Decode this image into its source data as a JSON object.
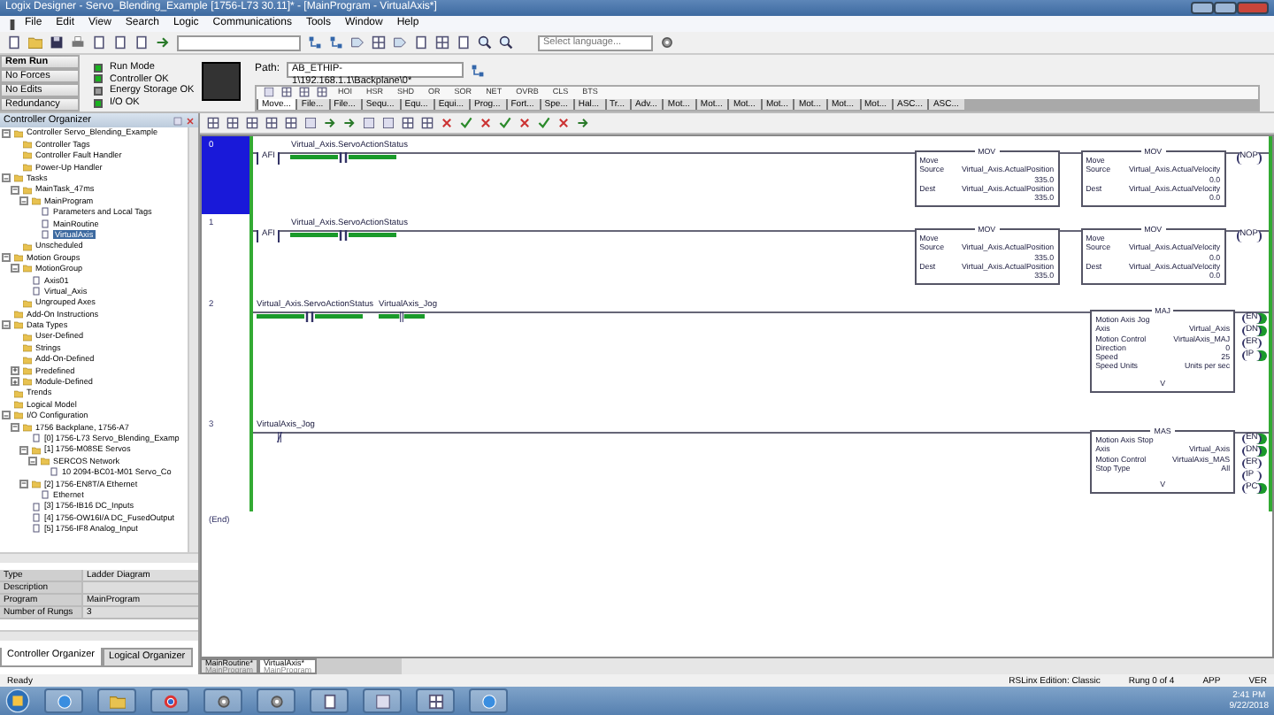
{
  "window": {
    "title": "Logix Designer - Servo_Blending_Example [1756-L73 30.11]* - [MainProgram - VirtualAxis*]"
  },
  "menu": [
    "File",
    "Edit",
    "View",
    "Search",
    "Logic",
    "Communications",
    "Tools",
    "Window",
    "Help"
  ],
  "language_field": {
    "placeholder": "Select language..."
  },
  "controller_status": {
    "modes": [
      {
        "label": "Rem Run"
      },
      {
        "label": "No Forces"
      },
      {
        "label": "No Edits"
      },
      {
        "label": "Redundancy"
      }
    ],
    "indicators": [
      {
        "label": "Run Mode",
        "on": true
      },
      {
        "label": "Controller OK",
        "on": true
      },
      {
        "label": "Energy Storage OK",
        "on": false
      },
      {
        "label": "I/O OK",
        "on": true
      }
    ]
  },
  "path": {
    "label": "Path:",
    "value": "AB_ETHIP-1\\192.168.1.1\\Backplane\\0*"
  },
  "instruction_buttons": [
    "HOI",
    "HSR",
    "SHD",
    "OR",
    "SOR",
    "NET",
    "OVRB",
    "CLS",
    "BTS"
  ],
  "instruction_tabs": [
    {
      "label": "Move...",
      "selected": true
    },
    {
      "label": "File...",
      "selected": false
    },
    {
      "label": "File...",
      "selected": false
    },
    {
      "label": "Sequ...",
      "selected": false
    },
    {
      "label": "Equ...",
      "selected": false
    },
    {
      "label": "Equi...",
      "selected": false
    },
    {
      "label": "Prog...",
      "selected": false
    },
    {
      "label": "Fort...",
      "selected": false
    },
    {
      "label": "Spe...",
      "selected": false
    },
    {
      "label": "Hal...",
      "selected": false
    },
    {
      "label": "Tr...",
      "selected": false
    },
    {
      "label": "Adv...",
      "selected": false
    },
    {
      "label": "Mot...",
      "selected": false
    },
    {
      "label": "Mot...",
      "selected": false
    },
    {
      "label": "Mot...",
      "selected": false
    },
    {
      "label": "Mot...",
      "selected": false
    },
    {
      "label": "Mot...",
      "selected": false
    },
    {
      "label": "Mot...",
      "selected": false
    },
    {
      "label": "Mot...",
      "selected": false
    },
    {
      "label": "ASC...",
      "selected": false
    },
    {
      "label": "ASC...",
      "selected": false
    }
  ],
  "organizer": {
    "title": "Controller Organizer",
    "tree": [
      {
        "label": "Controller Servo_Blending_Example",
        "expanded": true,
        "children": [
          {
            "label": "Controller Tags"
          },
          {
            "label": "Controller Fault Handler"
          },
          {
            "label": "Power-Up Handler"
          }
        ]
      },
      {
        "label": "Tasks",
        "expanded": true,
        "children": [
          {
            "label": "MainTask_47ms",
            "expanded": true,
            "children": [
              {
                "label": "MainProgram",
                "expanded": true,
                "children": [
                  {
                    "label": "Parameters and Local Tags"
                  },
                  {
                    "label": "MainRoutine"
                  },
                  {
                    "label": "VirtualAxis",
                    "selected": true
                  }
                ]
              }
            ]
          },
          {
            "label": "Unscheduled"
          }
        ]
      },
      {
        "label": "Motion Groups",
        "expanded": true,
        "children": [
          {
            "label": "MotionGroup",
            "expanded": true,
            "children": [
              {
                "label": "Axis01"
              },
              {
                "label": "Virtual_Axis"
              }
            ]
          },
          {
            "label": "Ungrouped Axes"
          }
        ]
      },
      {
        "label": "Add-On Instructions"
      },
      {
        "label": "Data Types",
        "expanded": true,
        "children": [
          {
            "label": "User-Defined"
          },
          {
            "label": "Strings"
          },
          {
            "label": "Add-On-Defined"
          },
          {
            "label": "Predefined",
            "expanded": false
          },
          {
            "label": "Module-Defined",
            "expanded": false
          }
        ]
      },
      {
        "label": "Trends"
      },
      {
        "label": "Logical Model"
      },
      {
        "label": "I/O Configuration",
        "expanded": true,
        "children": [
          {
            "label": "1756 Backplane, 1756-A7",
            "expanded": true,
            "children": [
              {
                "label": "[0] 1756-L73 Servo_Blending_Examp"
              },
              {
                "label": "[1] 1756-M08SE Servos",
                "expanded": true,
                "children": [
                  {
                    "label": "SERCOS Network",
                    "expanded": true,
                    "children": [
                      {
                        "label": "10 2094-BC01-M01 Servo_Co"
                      }
                    ]
                  }
                ]
              },
              {
                "label": "[2] 1756-EN8T/A Ethernet",
                "expanded": true,
                "children": [
                  {
                    "label": "Ethernet"
                  }
                ]
              },
              {
                "label": "[3] 1756-IB16 DC_Inputs"
              },
              {
                "label": "[4] 1756-OW16I/A DC_FusedOutput"
              },
              {
                "label": "[5] 1756-IF8 Analog_Input"
              }
            ]
          }
        ]
      }
    ]
  },
  "properties": [
    {
      "name": "Type",
      "value": "Ladder Diagram"
    },
    {
      "name": "Description"
    },
    {
      "name": "Program",
      "value": "MainProgram"
    },
    {
      "name": "Number of Rungs",
      "value": "3"
    }
  ],
  "organizer_tabs": [
    {
      "label": "Controller Organizer",
      "selected": true
    },
    {
      "label": "Logical Organizer",
      "selected": false
    }
  ],
  "rungs": [
    {
      "number": "0",
      "selected": true,
      "inputs": [
        {
          "kind": "afi",
          "label": "AFI"
        },
        {
          "kind": "xic",
          "tag": "Virtual_Axis.ServoActionStatus",
          "energized": true
        }
      ],
      "outputs": [
        {
          "kind": "box",
          "name": "MOV",
          "rows": [
            {
              "label": "Move"
            },
            {
              "label": "Source",
              "tag": "Virtual_Axis.ActualPosition",
              "value": "335.0"
            },
            {
              "label": "Dest",
              "tag": "Virtual_Axis.ActualPosition",
              "value": "335.0"
            }
          ]
        },
        {
          "kind": "box",
          "name": "MOV",
          "rows": [
            {
              "label": "Move"
            },
            {
              "label": "Source",
              "tag": "Virtual_Axis.ActualVelocity",
              "value": "0.0"
            },
            {
              "label": "Dest",
              "tag": "Virtual_Axis.ActualVelocity",
              "value": "0.0"
            }
          ]
        },
        {
          "kind": "coil",
          "label": "NOP"
        }
      ]
    },
    {
      "number": "1",
      "selected": false,
      "inputs": [
        {
          "kind": "afi",
          "label": "AFI"
        },
        {
          "kind": "xic",
          "tag": "Virtual_Axis.ServoActionStatus",
          "energized": true
        }
      ],
      "outputs": [
        {
          "kind": "box",
          "name": "MOV",
          "rows": [
            {
              "label": "Move"
            },
            {
              "label": "Source",
              "tag": "Virtual_Axis.ActualPosition",
              "value": "335.0"
            },
            {
              "label": "Dest",
              "tag": "Virtual_Axis.ActualPosition",
              "value": "335.0"
            }
          ]
        },
        {
          "kind": "box",
          "name": "MOV",
          "rows": [
            {
              "label": "Move"
            },
            {
              "label": "Source",
              "tag": "Virtual_Axis.ActualVelocity",
              "value": "0.0"
            },
            {
              "label": "Dest",
              "tag": "Virtual_Axis.ActualVelocity",
              "value": "0.0"
            }
          ]
        },
        {
          "kind": "coil",
          "label": "NOP"
        }
      ]
    },
    {
      "number": "2",
      "selected": false,
      "inputs": [
        {
          "kind": "xic",
          "tag": "Virtual_Axis.ServoActionStatus",
          "energized": true
        },
        {
          "kind": "xic",
          "tag": "VirtualAxis_Jog",
          "energized": true
        }
      ],
      "outputs": [
        {
          "kind": "box",
          "name": "MAJ",
          "rows": [
            {
              "label": "Motion Axis Jog"
            },
            {
              "label": "Axis",
              "tag": "Virtual_Axis"
            },
            {
              "label": "Motion Control",
              "tag": "VirtualAxis_MAJ"
            },
            {
              "label": "Direction",
              "tag": "0"
            },
            {
              "label": "Speed",
              "tag": "25"
            },
            {
              "label": "Speed Units",
              "tag": "Units per sec"
            }
          ],
          "footer": "V",
          "pins": [
            {
              "label": "EN",
              "on": true
            },
            {
              "label": "DN",
              "on": true
            },
            {
              "label": "ER",
              "on": false
            },
            {
              "label": "IP",
              "on": true
            }
          ]
        }
      ]
    },
    {
      "number": "3",
      "selected": false,
      "inputs": [
        {
          "kind": "xio",
          "tag": "VirtualAxis_Jog",
          "energized": false
        }
      ],
      "outputs": [
        {
          "kind": "box",
          "name": "MAS",
          "rows": [
            {
              "label": "Motion Axis Stop"
            },
            {
              "label": "Axis",
              "tag": "Virtual_Axis"
            },
            {
              "label": "Motion Control",
              "tag": "VirtualAxis_MAS"
            },
            {
              "label": "Stop Type",
              "tag": "All"
            }
          ],
          "footer": "V",
          "pins": [
            {
              "label": "EN",
              "on": true
            },
            {
              "label": "DN",
              "on": true
            },
            {
              "label": "ER",
              "on": false
            },
            {
              "label": "IP",
              "on": false
            },
            {
              "label": "PC",
              "on": true
            }
          ]
        }
      ]
    }
  ],
  "end_label": "(End)",
  "routine_tabs": [
    {
      "label": "MainRoutine*",
      "sublabel": "MainProgram",
      "selected": false
    },
    {
      "label": "VirtualAxis*",
      "sublabel": "MainProgram",
      "selected": true
    }
  ],
  "status_bar": {
    "left": "Ready",
    "items": [
      "RSLinx Edition: Classic",
      "Rung 0 of 4",
      "APP",
      "VER"
    ]
  },
  "taskbar": {
    "time": "2:41 PM",
    "date": "9/22/2018"
  }
}
